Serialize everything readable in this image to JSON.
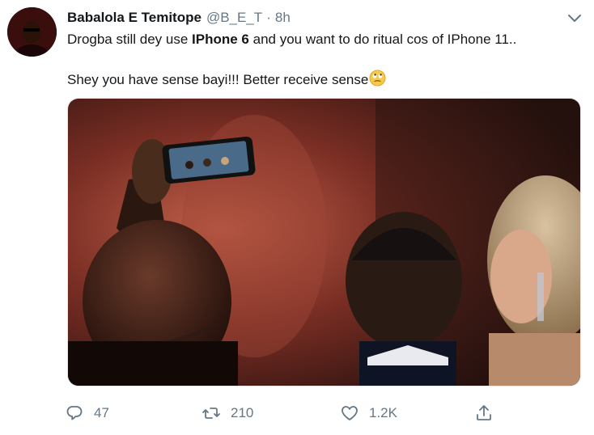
{
  "tweet": {
    "author_name": "Babalola E Temitope",
    "author_handle": "@B_E_T",
    "separator": "·",
    "time": "8h",
    "text_line1_part1": "Drogba still dey use ",
    "text_line1_bold": "IPhone 6",
    "text_line1_part2": " and you want to do ritual cos of IPhone 11..",
    "text_line2": "Shey you have sense bayi!!! Better receive sense",
    "emoji": "eye-roll-face-emoji"
  },
  "actions": {
    "reply_count": "47",
    "retweet_count": "210",
    "like_count": "1.2K"
  },
  "icons": {
    "reply": "reply-icon",
    "retweet": "retweet-icon",
    "like": "heart-icon",
    "share": "share-icon",
    "menu": "chevron-down-icon"
  },
  "colors": {
    "text": "#14171a",
    "secondary": "#657786",
    "border": "#e1e8ed"
  }
}
